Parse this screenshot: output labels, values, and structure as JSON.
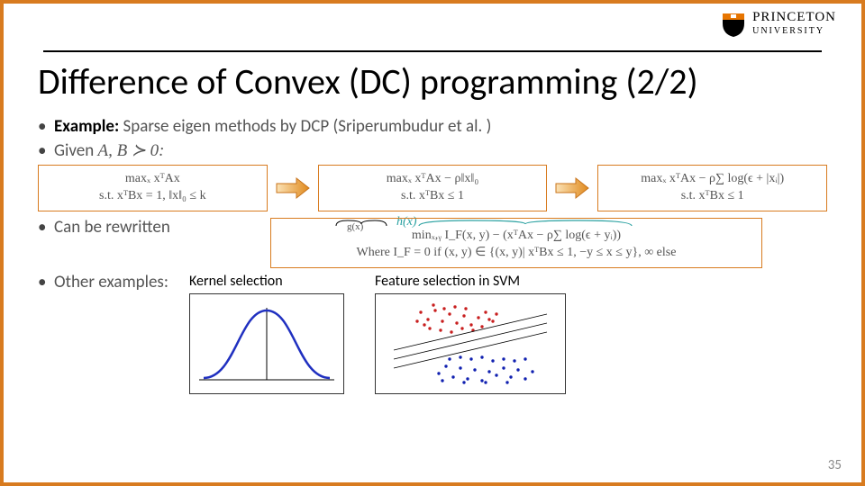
{
  "logo": {
    "line1": "PRINCETON",
    "line2": "UNIVERSITY"
  },
  "title": "Difference of Convex (DC) programming (2/2)",
  "example": {
    "label": "Example:",
    "text": "Sparse eigen methods by DCP (Sriperumbudur et al. )"
  },
  "given": {
    "label": "Given",
    "expr": "A, B ≻ 0:"
  },
  "box1": {
    "l1": "maxₓ xᵀAx",
    "l2": "s.t. xᵀBx = 1, ‖x‖₀ ≤ k"
  },
  "box2": {
    "l1": "maxₓ xᵀAx − ρ‖x‖₀",
    "l2": "s.t. xᵀBx ≤ 1"
  },
  "box3": {
    "l1": "maxₓ xᵀAx − ρ∑ log(ϵ + |xᵢ|)",
    "l2": "s.t. xᵀBx ≤ 1"
  },
  "hx": "h(x)",
  "rewrite_label": "Can be rewritten",
  "rewrite": {
    "l1": "minₓ,ᵧ I_F(x, y) − (xᵀAx − ρ∑ log(ϵ + yᵢ))",
    "brace_g": "g(x)",
    "l2": "Where I_F = 0 if (x, y) ∈ {(x, y)| xᵀBx ≤ 1, −y ≤ x ≤ y}, ∞ else"
  },
  "other_label": "Other examples:",
  "ex1": "Kernel selection",
  "ex2": "Feature selection in SVM",
  "page": "35",
  "chart_data": [
    {
      "type": "line",
      "title": "Kernel selection (Gaussian curve)",
      "x": [
        -3,
        -2,
        -1,
        0,
        1,
        2,
        3
      ],
      "values": [
        0.004,
        0.054,
        0.242,
        0.399,
        0.242,
        0.054,
        0.004
      ],
      "xlim": [
        -3.5,
        3.5
      ],
      "ylim": [
        0,
        0.45
      ]
    },
    {
      "type": "scatter",
      "title": "Feature selection in SVM",
      "series": [
        {
          "name": "class-red",
          "x": [
            1.0,
            1.2,
            1.4,
            1.5,
            1.7,
            1.8,
            2.0,
            2.1,
            2.3,
            2.5,
            2.7,
            2.8,
            3.0,
            3.2,
            3.5,
            1.6,
            1.9,
            2.2,
            2.4,
            2.6,
            2.9,
            1.3,
            1.1,
            1.8,
            2.0,
            2.3,
            2.6,
            2.8,
            3.1,
            3.3
          ],
          "y": [
            3.2,
            3.6,
            3.0,
            3.8,
            3.3,
            2.9,
            3.7,
            3.1,
            3.9,
            3.4,
            3.0,
            3.8,
            3.3,
            3.9,
            3.5,
            2.7,
            2.5,
            2.8,
            2.6,
            2.9,
            2.7,
            2.9,
            3.4,
            3.6,
            2.8,
            3.5,
            2.9,
            3.6,
            3.2,
            3.7
          ]
        },
        {
          "name": "class-blue",
          "x": [
            1.6,
            1.8,
            2.0,
            2.1,
            2.3,
            2.5,
            2.7,
            2.8,
            3.0,
            3.2,
            3.3,
            3.5,
            3.7,
            3.8,
            4.0,
            2.2,
            2.4,
            2.6,
            2.9,
            3.1,
            3.4,
            3.6,
            3.9,
            1.9,
            2.1,
            2.5,
            2.8,
            3.0,
            3.3,
            3.6
          ],
          "y": [
            0.8,
            1.2,
            0.6,
            1.4,
            1.0,
            0.5,
            1.3,
            0.7,
            1.5,
            1.1,
            0.6,
            1.4,
            0.9,
            1.5,
            1.2,
            0.4,
            0.9,
            0.5,
            1.0,
            0.6,
            1.1,
            0.7,
            1.3,
            1.6,
            1.8,
            1.7,
            1.9,
            1.6,
            1.8,
            1.7
          ]
        }
      ],
      "separators": [
        {
          "type": "line",
          "slope": 0.35,
          "intercept": 1.6
        },
        {
          "type": "line",
          "slope": 0.35,
          "intercept": 1.2
        },
        {
          "type": "line",
          "slope": 0.35,
          "intercept": 0.8
        }
      ],
      "xlim": [
        0.5,
        4.2
      ],
      "ylim": [
        0,
        4.2
      ]
    }
  ]
}
